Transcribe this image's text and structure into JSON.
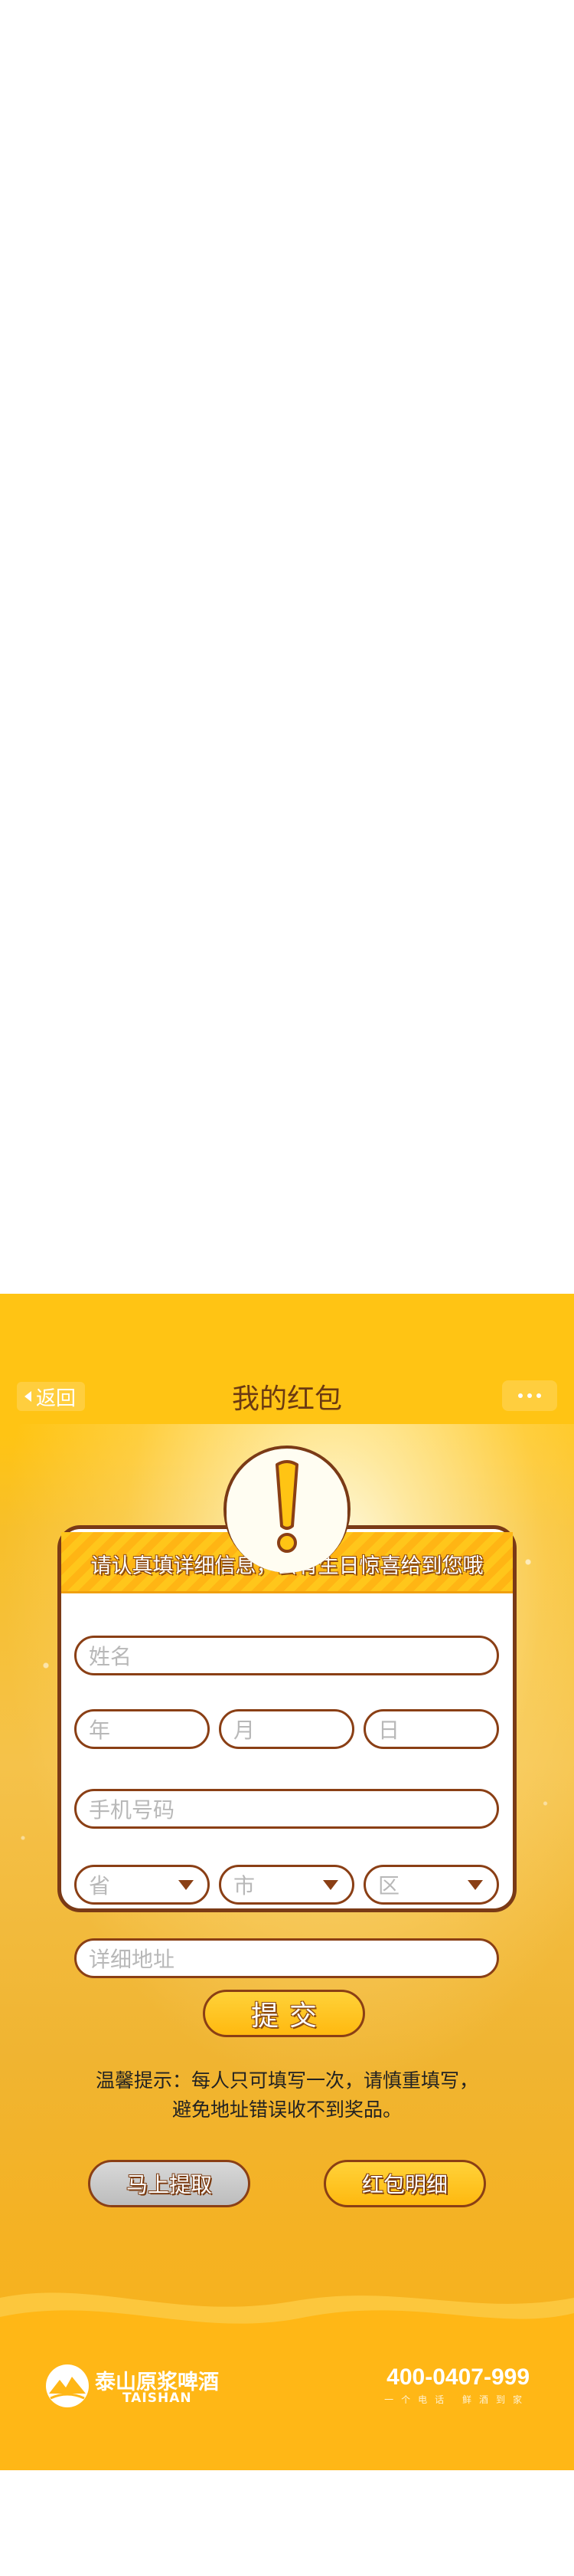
{
  "header": {
    "back_label": "返回",
    "title": "我的红包",
    "more_icon": "more-dots-icon"
  },
  "alert": {
    "icon": "exclamation-icon",
    "banner_text": "请认真填详细信息，会有生日惊喜给到您哦"
  },
  "form": {
    "name_placeholder": "姓名",
    "year_placeholder": "年",
    "month_placeholder": "月",
    "day_placeholder": "日",
    "phone_placeholder": "手机号码",
    "province_placeholder": "省",
    "city_placeholder": "市",
    "district_placeholder": "区",
    "address_placeholder": "详细地址",
    "submit_label": "提交"
  },
  "tip": {
    "line1": "温馨提示：每人只可填写一次，请慎重填写，",
    "line2": "避免地址错误收不到奖品。"
  },
  "actions": {
    "claim_label": "马上提取",
    "detail_label": "红包明细"
  },
  "footer": {
    "brand_cn": "泰山原浆啤酒",
    "brand_en": "TAISHAN",
    "phone": "400-0407-999",
    "phone_sub": "一个电话  鲜酒到家"
  },
  "colors": {
    "brand_yellow": "#ffc414",
    "outline_brown": "#8a3f15",
    "title_brown": "#6b3a12"
  }
}
